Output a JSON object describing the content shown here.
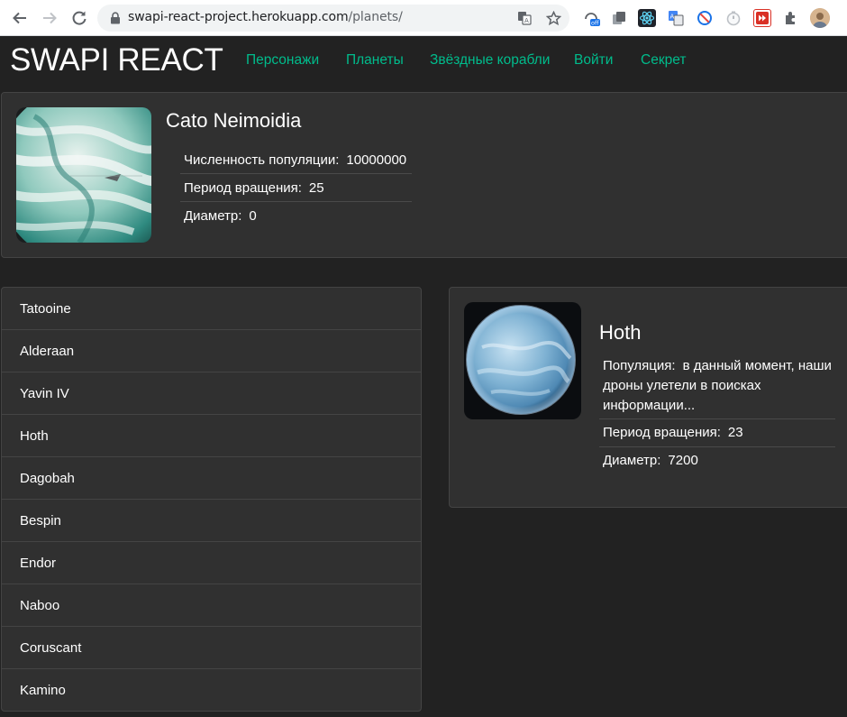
{
  "browser": {
    "url_host": "swapi-react-project.herokuapp.com",
    "url_path": "/planets/",
    "ext_badge": "off"
  },
  "header": {
    "brand": "SWAPI REACT",
    "nav": [
      {
        "label": "Персонажи"
      },
      {
        "label": "Планеты"
      },
      {
        "label": "Звёздные корабли"
      },
      {
        "label": "Войти"
      },
      {
        "label": "Секрет"
      }
    ],
    "accent_color": "#00bc8c"
  },
  "random_planet": {
    "name": "Cato Neimoidia",
    "image": "planet-cato-neimoidia",
    "details": [
      {
        "label": "Численность популяции:",
        "value": "10000000"
      },
      {
        "label": "Период вращения:",
        "value": "25"
      },
      {
        "label": "Диаметр:",
        "value": "0"
      }
    ]
  },
  "planet_list": {
    "items": [
      {
        "name": "Tatooine"
      },
      {
        "name": "Alderaan"
      },
      {
        "name": "Yavin IV"
      },
      {
        "name": "Hoth"
      },
      {
        "name": "Dagobah"
      },
      {
        "name": "Bespin"
      },
      {
        "name": "Endor"
      },
      {
        "name": "Naboo"
      },
      {
        "name": "Coruscant"
      },
      {
        "name": "Kamino"
      }
    ]
  },
  "selected_planet": {
    "name": "Hoth",
    "image": "planet-hoth",
    "details": [
      {
        "label": "Популяция:",
        "value": "в данный момент, наши дроны улетели в поисках информации..."
      },
      {
        "label": "Период вращения:",
        "value": "23"
      },
      {
        "label": "Диаметр:",
        "value": "7200"
      }
    ]
  }
}
